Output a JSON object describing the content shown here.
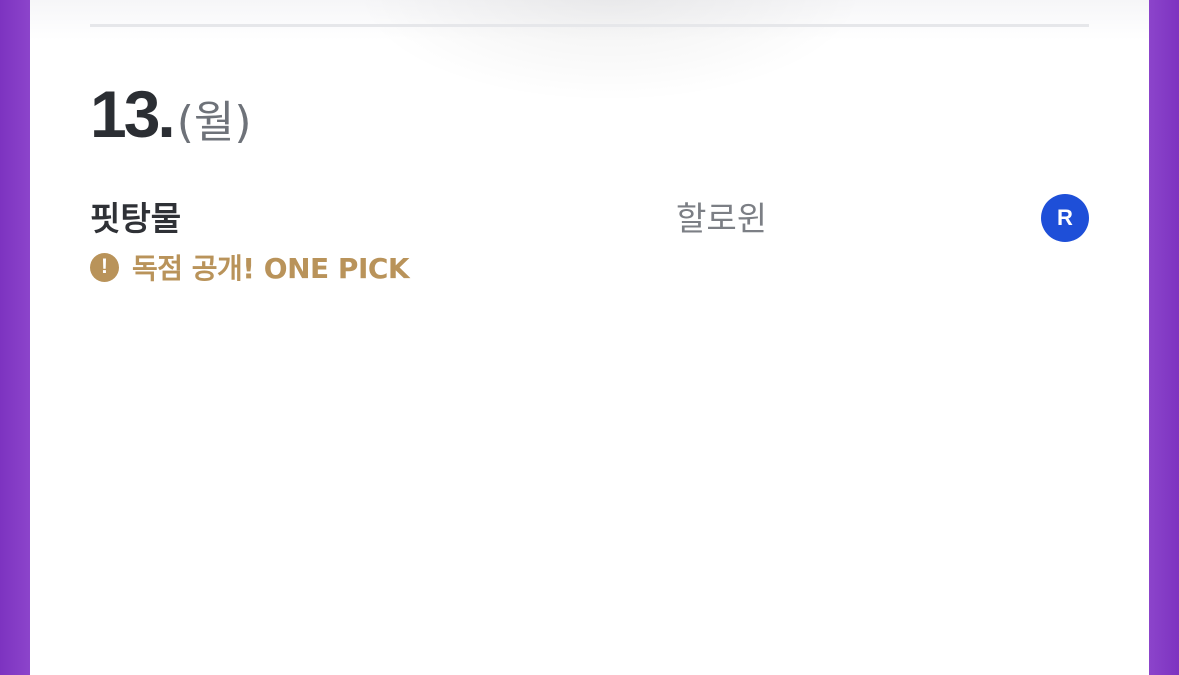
{
  "schedule": {
    "date_number": "13.",
    "day_of_week": "(월)"
  },
  "entry": {
    "title": "핏탕물",
    "genre": "할로윈",
    "rating_badge": "R",
    "notice_text": "독점 공개! ONE PICK",
    "notice_icon": "exclamation-circle-icon"
  },
  "colors": {
    "side_background": "#8a3fc7",
    "badge_blue": "#1e4fd8",
    "notice_gold": "#b9935a"
  }
}
